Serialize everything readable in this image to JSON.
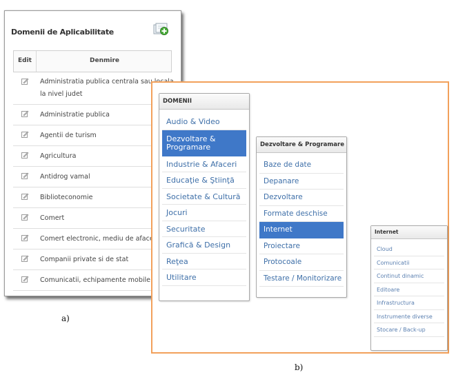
{
  "panel_a": {
    "title": "Domenii de Aplicabilitate",
    "columns": {
      "edit": "Edit",
      "name": "Denmire"
    },
    "rows": [
      {
        "lines": [
          "Administratia publica centrala sau locala",
          "la nivel judet"
        ]
      },
      {
        "lines": [
          "Administratie publica"
        ]
      },
      {
        "lines": [
          "Agentii de turism"
        ]
      },
      {
        "lines": [
          "Agricultura"
        ]
      },
      {
        "lines": [
          "Antidrog vamal"
        ]
      },
      {
        "lines": [
          "Biblioteconomie"
        ]
      },
      {
        "lines": [
          "Comert"
        ]
      },
      {
        "lines": [
          "Comert electronic, mediu de afaceri"
        ]
      },
      {
        "lines": [
          "Companii private si de stat"
        ]
      },
      {
        "lines": [
          "Comunicatii, echipamente mobile"
        ]
      }
    ],
    "caption": "a)"
  },
  "panel_b": {
    "menu_domenii": {
      "title": "DOMENII",
      "items": [
        "Audio & Video",
        "Dezvoltare & Programare",
        "Industrie & Afaceri",
        "Educaţie & Ştiinţă",
        "Societate & Cultură",
        "Jocuri",
        "Securitate",
        "Grafică & Design",
        "Reţea",
        "Utilitare"
      ],
      "selected": "Dezvoltare & Programare"
    },
    "menu_dezvoltare": {
      "title": "Dezvoltare & Programare",
      "items": [
        "Baze de date",
        "Depanare",
        "Dezvoltare",
        "Formate deschise",
        "Internet",
        "Proiectare",
        "Protocoale",
        "Testare / Monitorizare"
      ],
      "selected": "Internet"
    },
    "menu_internet": {
      "title": "Internet",
      "items": [
        "Cloud",
        "Comunicatii",
        "Continut dinamic",
        "Editoare",
        "Infrastructura",
        "Instrumente diverse",
        "Stocare / Back-up"
      ]
    },
    "caption": "b)"
  },
  "colors": {
    "selection": "#3f78c8",
    "link": "#3e6fa8",
    "frame_b": "#f2a05a"
  }
}
